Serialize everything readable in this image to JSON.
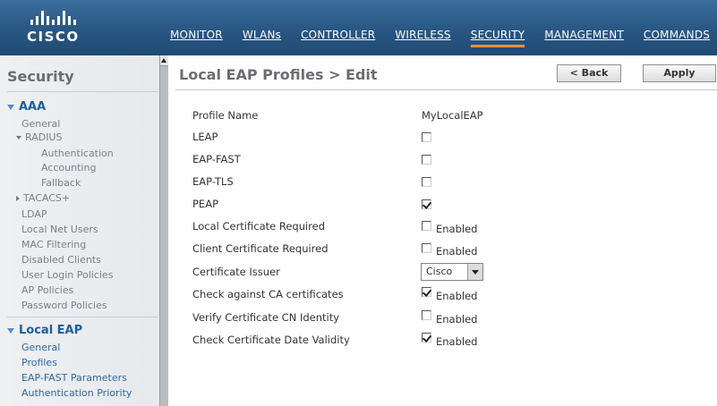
{
  "brand": {
    "name": "CISCO"
  },
  "nav": {
    "items": [
      "MONITOR",
      "WLANs",
      "CONTROLLER",
      "WIRELESS",
      "SECURITY",
      "MANAGEMENT",
      "COMMANDS"
    ],
    "active": "SECURITY",
    "accent_color": "#e8923a"
  },
  "sidebar": {
    "title": "Security",
    "aaa": {
      "label": "AAA",
      "general": "General",
      "radius": "RADIUS",
      "radius_items": [
        "Authentication",
        "Accounting",
        "Fallback"
      ],
      "tacacs": "TACACS+",
      "items": [
        "LDAP",
        "Local Net Users",
        "MAC Filtering",
        "Disabled Clients",
        "User Login Policies",
        "AP Policies",
        "Password Policies"
      ]
    },
    "local_eap": {
      "label": "Local EAP",
      "items": [
        "General",
        "Profiles",
        "EAP-FAST Parameters",
        "Authentication Priority"
      ]
    }
  },
  "main": {
    "title": "Local EAP Profiles > Edit",
    "back_label": "< Back",
    "apply_label": "Apply",
    "profile_name_label": "Profile Name",
    "profile_name_value": "MyLocalEAP",
    "rows": [
      {
        "label": "LEAP",
        "checked": false,
        "suffix": ""
      },
      {
        "label": "EAP-FAST",
        "checked": false,
        "suffix": ""
      },
      {
        "label": "EAP-TLS",
        "checked": false,
        "suffix": ""
      },
      {
        "label": "PEAP",
        "checked": true,
        "suffix": ""
      },
      {
        "label": "Local Certificate Required",
        "checked": false,
        "suffix": "Enabled"
      },
      {
        "label": "Client Certificate Required",
        "checked": false,
        "suffix": "Enabled"
      }
    ],
    "certificate_issuer_label": "Certificate Issuer",
    "certificate_issuer_value": "Cisco",
    "rows2": [
      {
        "label": "Check against CA certificates",
        "checked": true,
        "suffix": "Enabled"
      },
      {
        "label": "Verify Certificate CN Identity",
        "checked": false,
        "suffix": "Enabled"
      },
      {
        "label": "Check Certificate Date Validity",
        "checked": true,
        "suffix": "Enabled"
      }
    ]
  }
}
